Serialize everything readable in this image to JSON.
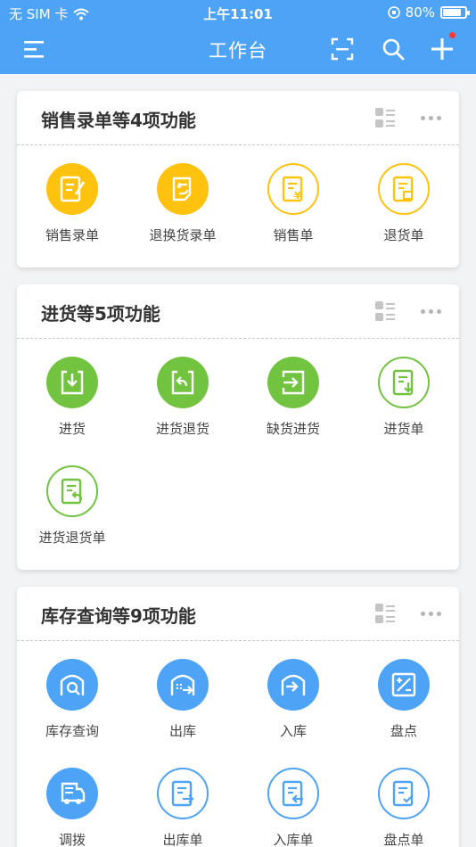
{
  "status": {
    "carrier": "无 SIM 卡",
    "time": "上午11:01",
    "battery": "80%"
  },
  "nav": {
    "title": "工作台"
  },
  "cards": [
    {
      "title": "销售录单等4项功能",
      "items": [
        {
          "label": "销售录单",
          "icon": "edit-doc-icon",
          "style": "filled-yellow"
        },
        {
          "label": "退换货录单",
          "icon": "exchange-doc-icon",
          "style": "filled-yellow"
        },
        {
          "label": "销售单",
          "icon": "sales-receipt-icon",
          "style": "line-yellow"
        },
        {
          "label": "退货单",
          "icon": "return-receipt-icon",
          "style": "line-yellow"
        }
      ]
    },
    {
      "title": "进货等5项功能",
      "items": [
        {
          "label": "进货",
          "icon": "download-box-icon",
          "style": "filled-green"
        },
        {
          "label": "进货退货",
          "icon": "return-box-icon",
          "style": "filled-green"
        },
        {
          "label": "缺货进货",
          "icon": "enter-box-icon",
          "style": "filled-green"
        },
        {
          "label": "进货单",
          "icon": "purchase-list-icon",
          "style": "line-green"
        },
        {
          "label": "进货退货单",
          "icon": "purchase-return-list-icon",
          "style": "line-green"
        }
      ]
    },
    {
      "title": "库存查询等9项功能",
      "items": [
        {
          "label": "库存查询",
          "icon": "warehouse-search-icon",
          "style": "filled-blue"
        },
        {
          "label": "出库",
          "icon": "warehouse-out-icon",
          "style": "filled-blue"
        },
        {
          "label": "入库",
          "icon": "warehouse-in-icon",
          "style": "filled-blue"
        },
        {
          "label": "盘点",
          "icon": "stocktake-icon",
          "style": "filled-blue"
        },
        {
          "label": "调拨",
          "icon": "transfer-truck-icon",
          "style": "filled-blue"
        },
        {
          "label": "出库单",
          "icon": "out-list-icon",
          "style": "line-blue"
        },
        {
          "label": "入库单",
          "icon": "in-list-icon",
          "style": "line-blue"
        },
        {
          "label": "盘点单",
          "icon": "stocktake-list-icon",
          "style": "line-blue"
        }
      ]
    }
  ],
  "colors": {
    "primary": "#4da3f5",
    "yellow": "#ffc20e",
    "green": "#72c340"
  }
}
